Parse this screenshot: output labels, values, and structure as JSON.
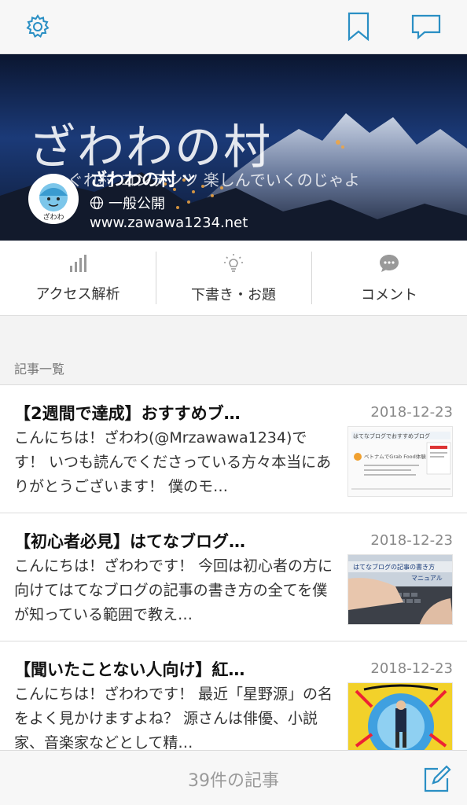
{
  "colors": {
    "accent": "#2a8fc4",
    "text": "#222222",
    "muted": "#888888"
  },
  "topbar": {
    "icons": [
      "gear-icon",
      "bookmark-icon",
      "chat-icon"
    ]
  },
  "hero": {
    "header_title": "ざわわの村",
    "header_subtitle": "ぐれ村 コンテンツ 楽しんでいくのじゃよ",
    "blog_name": "ざわわの村",
    "visibility": "一般公開",
    "url": "www.zawawa1234.net",
    "avatar_text": "ざわわ"
  },
  "actions": [
    {
      "label": "アクセス解析",
      "icon": "bar-chart-icon"
    },
    {
      "label": "下書き・お題",
      "icon": "lightbulb-icon"
    },
    {
      "label": "コメント",
      "icon": "comment-icon"
    }
  ],
  "section_label": "記事一覧",
  "articles": [
    {
      "title": "【2週間で達成】おすすめブ…",
      "date": "2018-12-23",
      "excerpt": "こんにちは！ざわわ(@Mrzawawa1234)です！ いつも読んでくださっている方々本当にありがとうございます！ 僕のモ…",
      "thumb_text_1": "はてなブログでおすすめブログ",
      "thumb_text_2": "ベトナムでGrab Food体験"
    },
    {
      "title": "【初心者必見】はてなブログ…",
      "date": "2018-12-23",
      "excerpt": "こんにちは！ざわわです！ 今回は初心者の方に向けてはてなブログの記事の書き方の全てを僕が知っている範囲で教え…",
      "thumb_text_1": "はてなブログの記事の書き方",
      "thumb_text_2": "マニュアル"
    },
    {
      "title": "【聞いたことない人向け】紅…",
      "date": "2018-12-23",
      "excerpt": "こんにちは！ざわわです！ 最近「星野源」の名をよく見かけますよね？ 源さんは俳優、小説家、音楽家などとして精…",
      "thumb_text_1": "",
      "thumb_text_2": ""
    }
  ],
  "footer": {
    "count_label": "39件の記事"
  }
}
